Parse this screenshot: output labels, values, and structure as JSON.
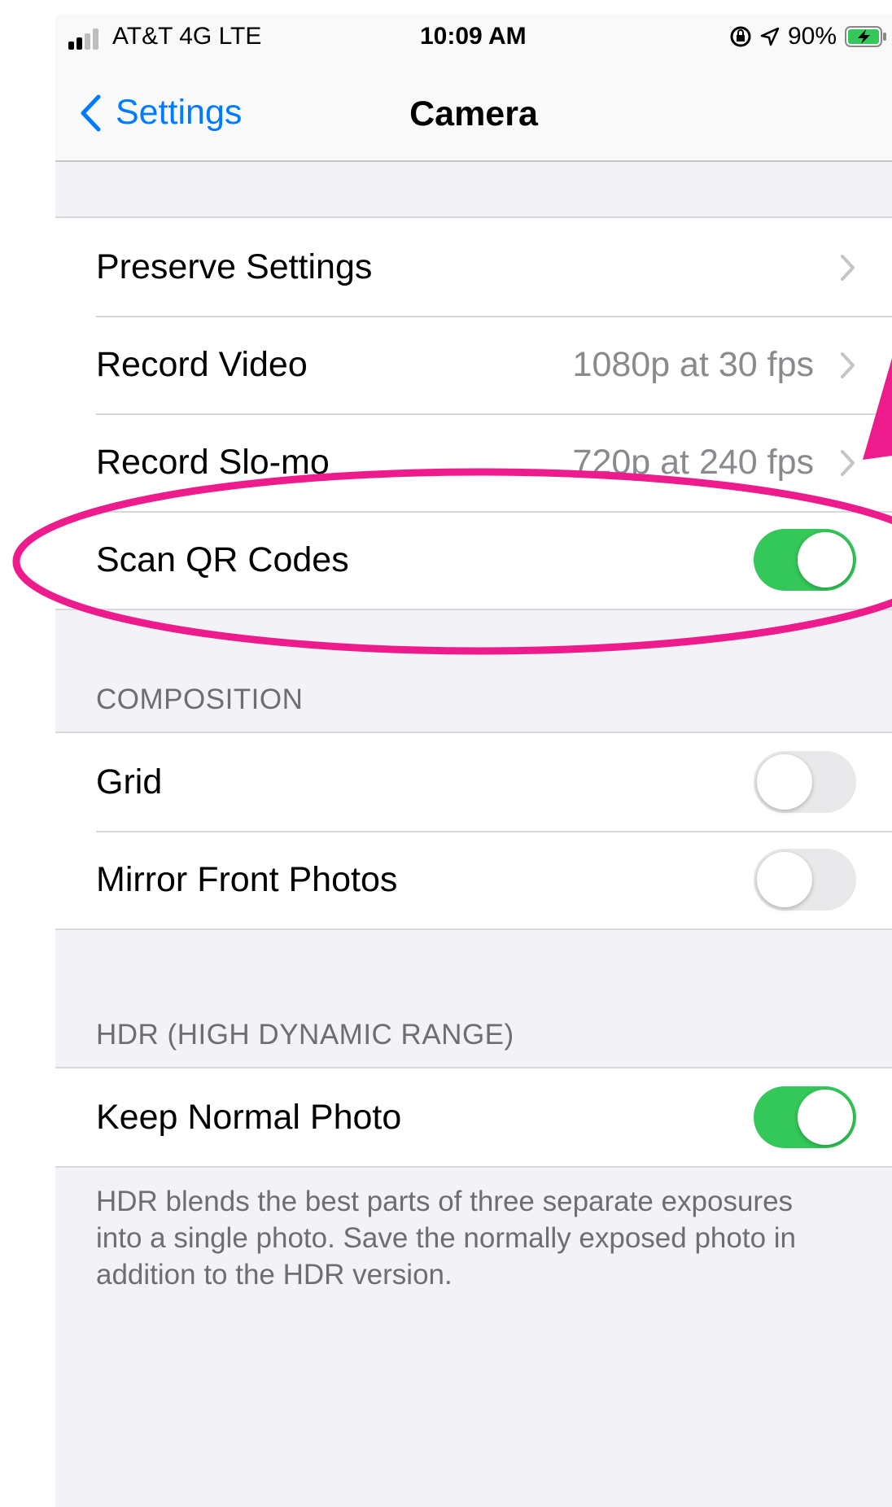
{
  "status_bar": {
    "carrier": "AT&T 4G  LTE",
    "time": "10:09 AM",
    "battery": "90%",
    "icons": [
      "signal-icon",
      "orientation-lock-icon",
      "location-icon",
      "battery-charging-icon"
    ]
  },
  "nav": {
    "back_label": "Settings",
    "title": "Camera"
  },
  "group1": {
    "rows": [
      {
        "label": "Preserve Settings",
        "value": ""
      },
      {
        "label": "Record Video",
        "value": "1080p at 30 fps"
      },
      {
        "label": "Record Slo-mo",
        "value": "720p at 240 fps"
      },
      {
        "label": "Scan QR Codes",
        "toggle": true
      }
    ]
  },
  "composition": {
    "header": "COMPOSITION",
    "rows": [
      {
        "label": "Grid",
        "toggle": false
      },
      {
        "label": "Mirror Front Photos",
        "toggle": false
      }
    ]
  },
  "hdr": {
    "header": "HDR (HIGH DYNAMIC RANGE)",
    "rows": [
      {
        "label": "Keep Normal Photo",
        "toggle": true
      }
    ],
    "footer": "HDR blends the best parts of three separate exposures into a single photo. Save the normally exposed photo in addition to the HDR version."
  },
  "colors": {
    "accent": "#007aff",
    "toggle_on": "#34c759",
    "annotation": "#ee1b8c"
  }
}
